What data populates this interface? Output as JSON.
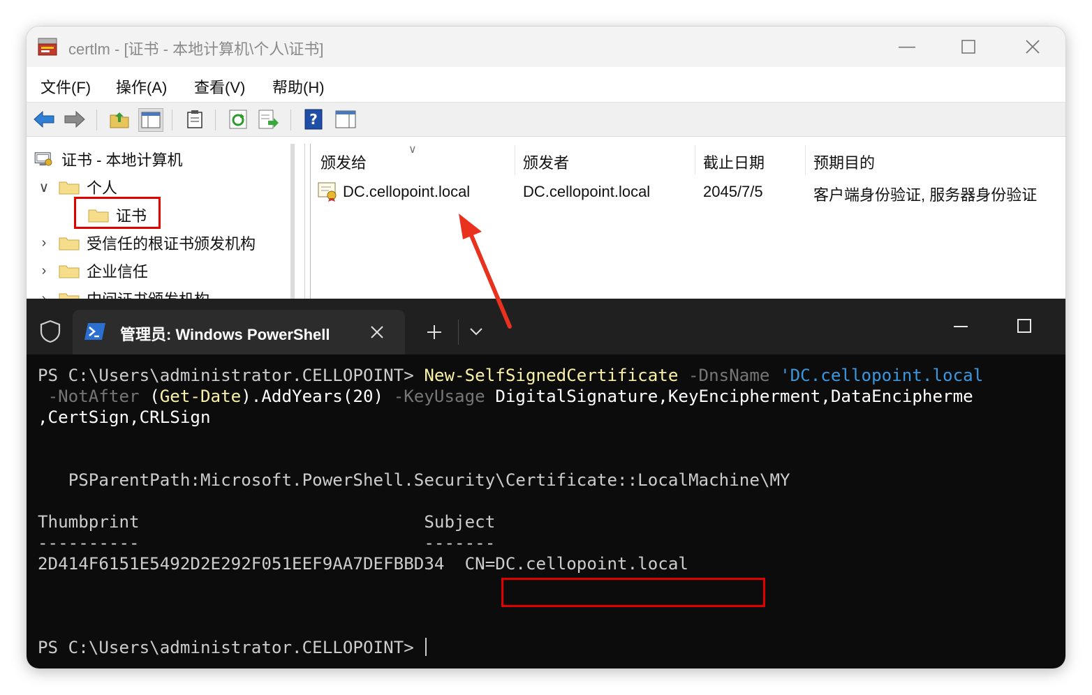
{
  "mmc": {
    "title": "certlm - [证书 - 本地计算机\\个人\\证书]",
    "menu": [
      "文件(F)",
      "操作(A)",
      "查看(V)",
      "帮助(H)"
    ],
    "tree": {
      "root": "证书 - 本地计算机",
      "personal": "个人",
      "certificates": "证书",
      "trusted_root": "受信任的根证书颁发机构",
      "enterprise_trust": "企业信任",
      "intermediate": "中间证书颁发机构"
    },
    "columns": [
      "颁发给",
      "颁发者",
      "截止日期",
      "预期目的"
    ],
    "rows": [
      {
        "issued_to": "DC.cellopoint.local",
        "issued_by": "DC.cellopoint.local",
        "expiration": "2045/7/5",
        "purposes": "客户端身份验证, 服务器身份验证"
      }
    ]
  },
  "terminal": {
    "tab_title": "管理员: Windows PowerShell",
    "prompt1": "PS C:\\Users\\administrator.CELLOPOINT>",
    "cmd": "New-SelfSignedCertificate",
    "param_dnsname": "-DnsName",
    "value_dnsname": "'DC.cellopoint.local",
    "param_notafter": "-NotAfter",
    "expr_open": "(",
    "expr_cmd": "Get-Date",
    "expr_rest": ").AddYears(20)",
    "param_keyusage": "-KeyUsage",
    "keyusage_values": "DigitalSignature,KeyEncipherment,DataEncipherme",
    "line3": ",CertSign,CRLSign",
    "psparentpath": "PSParentPath:Microsoft.PowerShell.Security\\Certificate::LocalMachine\\MY",
    "header_thumbprint": "Thumbprint",
    "header_subject": "Subject",
    "underline_thumbprint": "----------",
    "underline_subject": "-------",
    "thumbprint": "2D414F6151E5492D2E292F051EEF9AA7DEFBBD34",
    "subject": "CN=DC.cellopoint.local",
    "prompt2": "PS C:\\Users\\administrator.CELLOPOINT>"
  },
  "colors": {
    "annotation_red": "#e00000",
    "terminal_bg": "#0c0c0c",
    "cmdlet_yellow": "#f9f1a5",
    "string_cyan": "#3a96dd"
  }
}
